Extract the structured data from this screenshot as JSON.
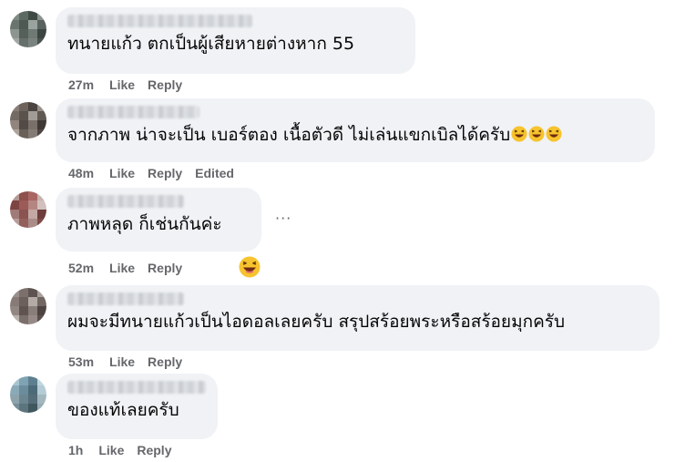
{
  "comments": [
    {
      "text": "ทนายแก้ว ตกเป็นผู้เสียหายต่างหาก 55",
      "time": "27m",
      "like": "Like",
      "reply": "Reply",
      "avatar_colors": [
        "#7f8b84",
        "#5d6a63",
        "#3f4a45",
        "#8a938e",
        "#6b7570",
        "#4e5954",
        "#9aa39e",
        "#5a625e",
        "#8c9590",
        "#55605b",
        "#707a75",
        "#3c4541",
        "#a1a8a4",
        "#666f6b",
        "#7a837f",
        "#4a524e"
      ]
    },
    {
      "text": "จากภาพ น่าจะเป็น เบอร์ตอง เนื้อตัวดี ไม่เล่นแขกเบิลได้ครับ",
      "emoji_count": 3,
      "time": "48m",
      "like": "Like",
      "reply": "Reply",
      "edited": "Edited",
      "avatar_colors": [
        "#8a7f78",
        "#6e625c",
        "#4b433f",
        "#99908a",
        "#746a64",
        "#5a524d",
        "#a39b95",
        "#605853",
        "#91857e",
        "#534a45",
        "#7a706a",
        "#403835",
        "#aea49e",
        "#6a605a",
        "#857b75",
        "#4d4541"
      ]
    },
    {
      "text": "ภาพหลุด ก็เช่นกันค่ะ",
      "time": "52m",
      "like": "Like",
      "reply": "Reply",
      "reaction_emoji": "laughing-emoji",
      "avatar_colors": [
        "#b39a96",
        "#8e4f4d",
        "#a86663",
        "#c7b2ae",
        "#7d4442",
        "#9c5b57",
        "#b48682",
        "#d1c0bd",
        "#a07b78",
        "#8a5350",
        "#c4a8a4",
        "#6f3d3b",
        "#b99e9a",
        "#94605c",
        "#aa8c88",
        "#7c4a47"
      ]
    },
    {
      "text": "ผมจะมีทนายแก้วเป็นไอดอลเลยครับ สรุปสร้อยพระหรือสร้อยมุกครับ",
      "time": "53m",
      "like": "Like",
      "reply": "Reply",
      "avatar_colors": [
        "#9a8f8c",
        "#7c706c",
        "#5e5350",
        "#a9a09c",
        "#877b77",
        "#6b605c",
        "#b4aba7",
        "#716662",
        "#938783",
        "#5f5450",
        "#8a7e7a",
        "#4d4340",
        "#bab2ae",
        "#7a6f6b",
        "#958a86",
        "#5a4f4c"
      ]
    },
    {
      "text": "ของแท้เลยครับ",
      "time": "1h",
      "like": "Like",
      "reply": "Reply",
      "avatar_colors": [
        "#a8c4d0",
        "#7fa3b3",
        "#5d7f8f",
        "#c2d6de",
        "#8aaab8",
        "#6b8c9b",
        "#4c6b79",
        "#b5ccd6",
        "#8ea4ad",
        "#6c8691",
        "#546d78",
        "#a3b7bf",
        "#778f99",
        "#5c747e",
        "#41575f",
        "#98adb5"
      ]
    }
  ],
  "more_label": "···"
}
